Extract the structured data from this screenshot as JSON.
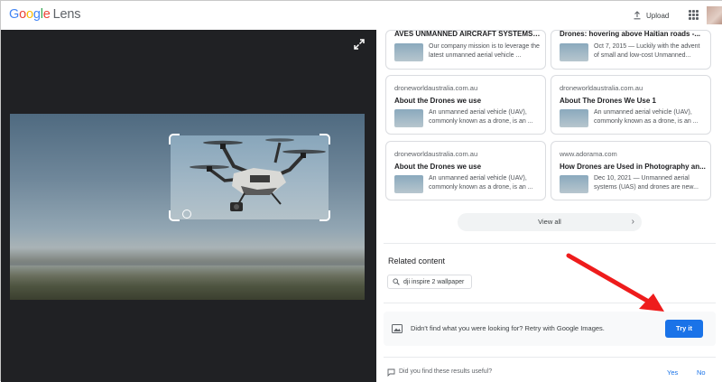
{
  "header": {
    "logo_google": [
      "G",
      "o",
      "o",
      "g",
      "l",
      "e"
    ],
    "logo_lens": "Lens",
    "upload_label": "Upload"
  },
  "results": [
    {
      "domain": "",
      "title": "AVES UNMANNED AIRCRAFT SYSTEMS L...",
      "snippet": "Our company mission is to leverage the latest unmanned aerial vehicle ..."
    },
    {
      "domain": "",
      "title": "Drones: hovering above Haitian roads -...",
      "snippet": "Oct 7, 2015 — Luckily with the advent of small and low-cost Unmanned..."
    },
    {
      "domain": "droneworldaustralia.com.au",
      "title": "About the Drones we use",
      "snippet": "An unmanned aerial vehicle (UAV), commonly known as a drone, is an ..."
    },
    {
      "domain": "droneworldaustralia.com.au",
      "title": "About The Drones We Use 1",
      "snippet": "An unmanned aerial vehicle (UAV), commonly known as a drone, is an ..."
    },
    {
      "domain": "droneworldaustralia.com.au",
      "title": "About the Drones we use",
      "snippet": "An unmanned aerial vehicle (UAV), commonly known as a drone, is an ..."
    },
    {
      "domain": "www.adorama.com",
      "title": "How Drones are Used in Photography an...",
      "snippet": "Dec 10, 2021 — Unmanned aerial systems (UAS) and drones are new..."
    }
  ],
  "view_all_label": "View all",
  "related": {
    "heading": "Related content",
    "chip_label": "dji inspire 2 wallpaper"
  },
  "retry": {
    "text": "Didn't find what you were looking for? Retry with Google Images.",
    "button_label": "Try it"
  },
  "feedback": {
    "question": "Did you find these results useful?",
    "yes_label": "Yes",
    "no_label": "No"
  },
  "colors": {
    "accent_blue": "#1a73e8",
    "annotation_arrow": "#ee1c1c",
    "viewer_bg": "#202124"
  },
  "icons": [
    "upload-icon",
    "apps-grid-icon",
    "expand-icon",
    "search-icon",
    "image-search-icon",
    "feedback-icon",
    "chevron-right-icon"
  ]
}
